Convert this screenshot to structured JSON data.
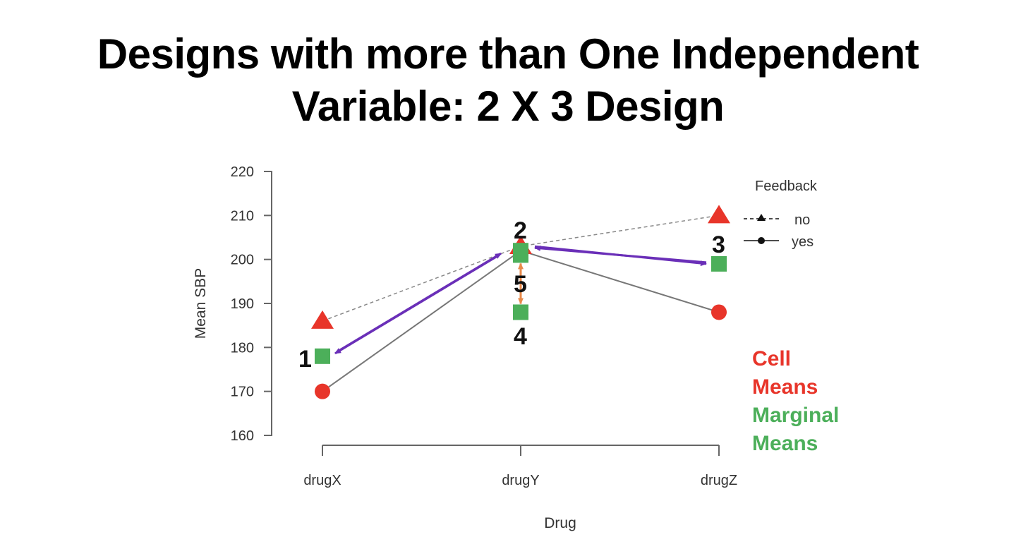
{
  "slide": {
    "title_line1": "Designs with more than One Independent",
    "title_line2": "Variable: 2 X 3 Design"
  },
  "chart_data": {
    "type": "line",
    "title": "Designs with more than One Independent Variable: 2 X 3 Design",
    "xlabel": "Drug",
    "ylabel": "Mean SBP",
    "categories": [
      "drugX",
      "drugY",
      "drugZ"
    ],
    "ylim": [
      160,
      220
    ],
    "yticks": [
      160,
      170,
      180,
      190,
      200,
      210,
      220
    ],
    "legend": {
      "title": "Feedback",
      "position": "top-right",
      "entries": [
        "no",
        "yes"
      ]
    },
    "series": [
      {
        "name": "no",
        "line": "dashed",
        "marker": "triangle",
        "values": [
          186,
          203,
          210
        ]
      },
      {
        "name": "yes",
        "line": "solid",
        "marker": "circle",
        "values": [
          170,
          202,
          188
        ]
      }
    ],
    "marginal_means": {
      "drug": {
        "categories": [
          "drugX",
          "drugY",
          "drugZ"
        ],
        "values": [
          178,
          202,
          199
        ]
      },
      "feedback_at_drugY": [
        201,
        188
      ]
    },
    "annotations": [
      {
        "text": "1",
        "near": "drugX marginal"
      },
      {
        "text": "2",
        "near": "drugY marginal"
      },
      {
        "text": "3",
        "near": "drugZ marginal"
      },
      {
        "text": "4",
        "near": "drugY lower marginal"
      },
      {
        "text": "5",
        "near": "drugY double arrow"
      }
    ],
    "key_text": {
      "cell_line1": "Cell",
      "cell_line2": "Means",
      "marginal_line1": "Marginal",
      "marginal_line2": "Means"
    },
    "colors": {
      "cell": "#e8352a",
      "marginal": "#4caf5a",
      "arrow": "#6a2fb8",
      "diff_arrow": "#e8894a",
      "line": "#666666"
    }
  }
}
